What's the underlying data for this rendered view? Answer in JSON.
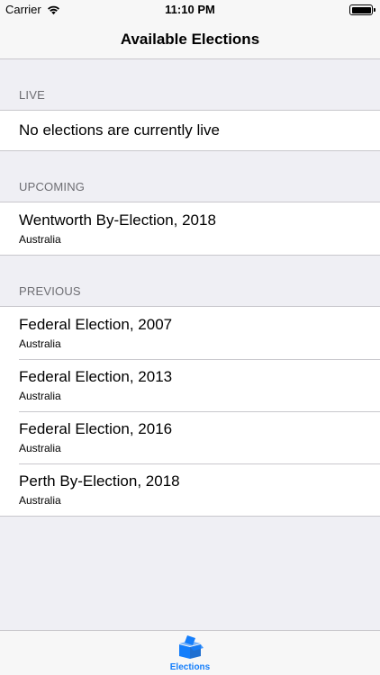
{
  "status": {
    "carrier": "Carrier",
    "time": "11:10 PM",
    "wifi_icon": "wifi-icon",
    "battery_icon": "battery-icon"
  },
  "nav": {
    "title": "Available Elections"
  },
  "sections": {
    "live": {
      "header": "LIVE",
      "empty_text": "No elections are currently live"
    },
    "upcoming": {
      "header": "UPCOMING",
      "items": [
        {
          "title": "Wentworth By-Election, 2018",
          "subtitle": "Australia"
        }
      ]
    },
    "previous": {
      "header": "PREVIOUS",
      "items": [
        {
          "title": "Federal Election, 2007",
          "subtitle": "Australia"
        },
        {
          "title": "Federal Election, 2013",
          "subtitle": "Australia"
        },
        {
          "title": "Federal Election, 2016",
          "subtitle": "Australia"
        },
        {
          "title": "Perth By-Election, 2018",
          "subtitle": "Australia"
        }
      ]
    }
  },
  "tab_bar": {
    "items": [
      {
        "label": "Elections",
        "icon": "ballot-box-icon",
        "selected": true
      }
    ]
  },
  "colors": {
    "accent": "#147efb",
    "background": "#efeff4",
    "section_header_text": "#6d6d72",
    "separator": "#c8c7cc"
  }
}
